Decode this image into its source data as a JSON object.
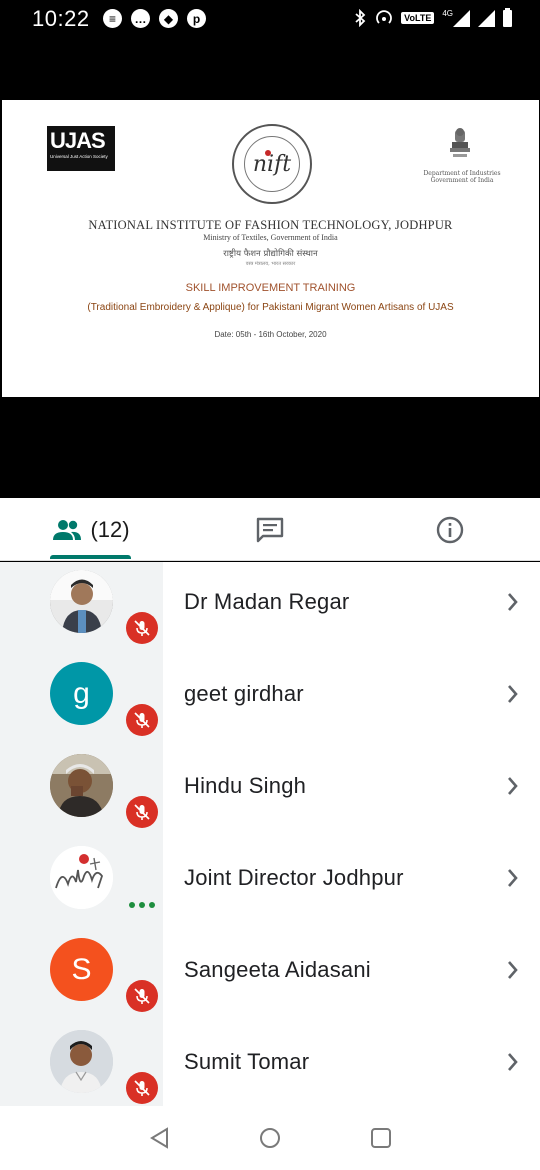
{
  "status_bar": {
    "time": "10:22",
    "notification_icons": [
      "chat-bubble-icon",
      "message-icon",
      "share-icon",
      "pinterest-icon"
    ],
    "volte_label": "VoLTE",
    "network_label": "4G"
  },
  "slide": {
    "ujas_logo_text": "UJAS",
    "ujas_logo_subtext": "Universal Just Action Society",
    "goi_text_line1": "Department of Industries",
    "goi_text_line2": "Government of India",
    "institute": "NATIONAL INSTITUTE OF FASHION TECHNOLOGY, JODHPUR",
    "ministry": "Ministry of Textiles, Government of India",
    "hindi_name": "राष्ट्रीय फैशन प्रौद्योगिकी संस्थान",
    "hindi_ministry": "वस्त्र मंत्रालय, भारत सरकार",
    "heading": "SKILL IMPROVEMENT TRAINING",
    "description": "(Traditional Embroidery & Applique) for Pakistani Migrant Women Artisans of UJAS",
    "date": "Date: 05th - 16th October, 2020"
  },
  "tabs": {
    "people_count": "(12)",
    "accent": "#00796b"
  },
  "participants": [
    {
      "name": "Dr Madan Regar",
      "avatar": "photo",
      "muted": true
    },
    {
      "name": "geet girdhar",
      "avatar": "letter",
      "initial": "g",
      "color": "#0097a7",
      "muted": true
    },
    {
      "name": "Hindu Singh",
      "avatar": "photo",
      "muted": true
    },
    {
      "name": "Joint Director Jodhpur",
      "avatar": "logo",
      "muted": false,
      "speaking": true
    },
    {
      "name": "Sangeeta Aidasani",
      "avatar": "letter",
      "initial": "S",
      "color": "#f4511e",
      "muted": true
    },
    {
      "name": "Sumit Tomar",
      "avatar": "photo",
      "muted": true
    }
  ],
  "colors": {
    "mute_red": "#d93025",
    "speaking_green": "#1e8e3e"
  }
}
